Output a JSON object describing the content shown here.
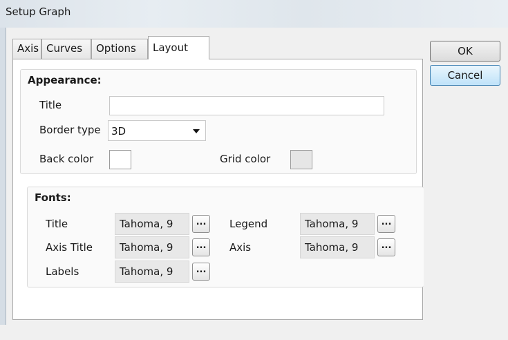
{
  "window": {
    "title": "Setup Graph"
  },
  "tabs": [
    {
      "label": "Axis"
    },
    {
      "label": "Curves"
    },
    {
      "label": "Options"
    },
    {
      "label": "Layout"
    }
  ],
  "active_tab": "Layout",
  "appearance": {
    "heading": "Appearance:",
    "title_label": "Title",
    "title_value": "",
    "border_type_label": "Border type",
    "border_type_value": "3D",
    "back_color_label": "Back color",
    "back_color": "#ffffff",
    "grid_color_label": "Grid color",
    "grid_color": "#e6e6e6"
  },
  "fonts": {
    "heading": "Fonts:",
    "title_label": "Title",
    "title_value": "Tahoma, 9",
    "axis_title_label": "Axis Title",
    "axis_title_value": "Tahoma, 9",
    "labels_label": "Labels",
    "labels_value": "Tahoma, 9",
    "legend_label": "Legend",
    "legend_value": "Tahoma, 9",
    "axis_label": "Axis",
    "axis_value": "Tahoma, 9",
    "browse_label": "..."
  },
  "buttons": {
    "ok": "OK",
    "cancel": "Cancel"
  }
}
